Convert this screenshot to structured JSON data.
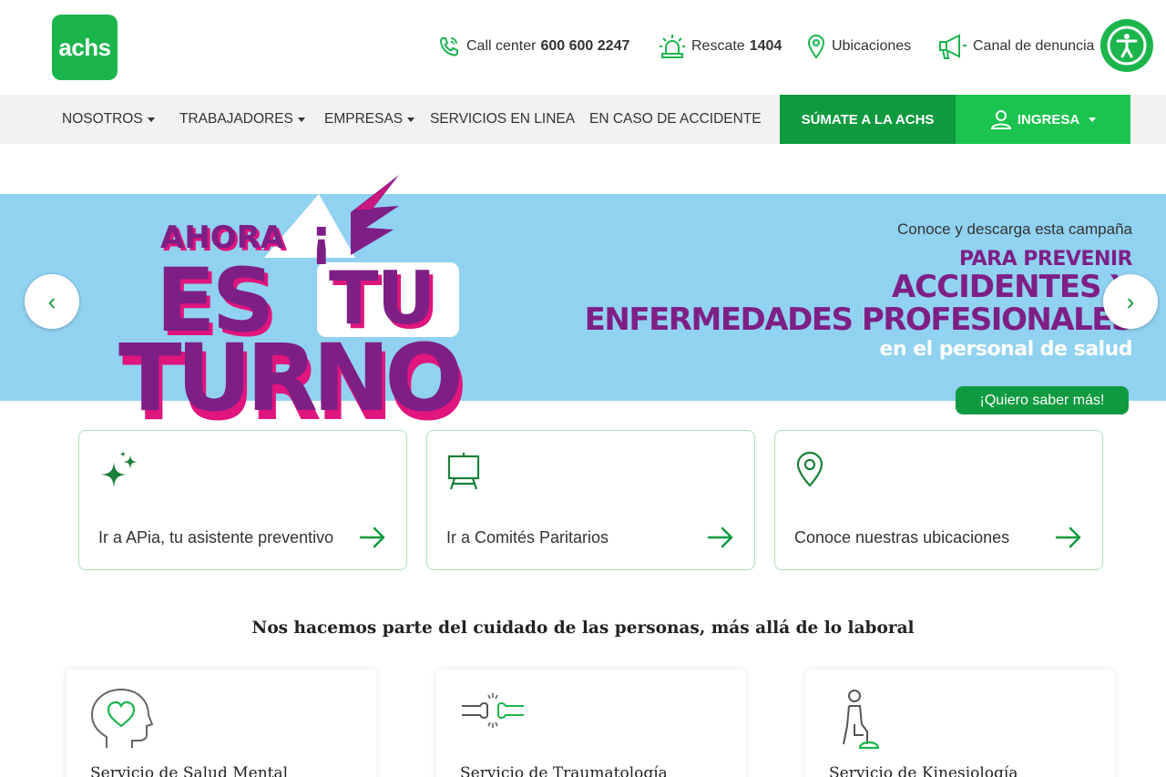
{
  "header": {
    "logo_text": "achs",
    "utility_links": [
      {
        "label": "Call center",
        "value": "600 600 2247",
        "icon": "phone-icon"
      },
      {
        "label": "Rescate",
        "value": "1404",
        "icon": "siren-icon"
      },
      {
        "label": "Ubicaciones",
        "icon": "location-pin-icon"
      },
      {
        "label": "Canal de denuncia",
        "icon": "megaphone-icon"
      }
    ],
    "accessibility_icon": "accessibility-icon"
  },
  "nav": {
    "items": [
      {
        "label": "NOSOTROS",
        "dropdown": true
      },
      {
        "label": "TRABAJADORES",
        "dropdown": true
      },
      {
        "label": "EMPRESAS",
        "dropdown": true
      },
      {
        "label": "SERVICIOS EN LINEA",
        "dropdown": false
      },
      {
        "label": "EN CASO DE ACCIDENTE",
        "dropdown": false
      }
    ],
    "join_label": "SÚMATE A LA ACHS",
    "login_label": "INGRESA"
  },
  "hero": {
    "art_text": {
      "line1": "AHORA",
      "exclaim": "¡",
      "line2a": "ES",
      "line2b": "TU",
      "line3": "TURNO"
    },
    "kicker": "Conoce y descarga esta campaña",
    "line1": "PARA PREVENIR",
    "line2": "ACCIDENTES Y",
    "line3": "ENFERMEDADES PROFESIONALES",
    "line4": "en el personal de salud",
    "cta_label": "¡Quiero saber más!",
    "prev_arrow": "‹",
    "next_arrow": "›",
    "colors": {
      "background": "#91d2f1",
      "purple": "#7e1f86",
      "pink": "#e0157d"
    }
  },
  "quick_links": [
    {
      "label": "Ir a APia, tu asistente preventivo",
      "icon": "sparkles-icon"
    },
    {
      "label": "Ir a Comités Paritarios",
      "icon": "easel-icon"
    },
    {
      "label": "Conoce nuestras ubicaciones",
      "icon": "location-pin-icon"
    }
  ],
  "section": {
    "title": "Nos hacemos parte del cuidado de las personas, más allá de lo laboral",
    "services": [
      {
        "label": "Servicio de Salud Mental",
        "icon": "head-heart-icon"
      },
      {
        "label": "Servicio de Traumatología",
        "icon": "bone-joint-icon"
      },
      {
        "label": "Servicio de Kinesiología",
        "icon": "person-step-icon"
      }
    ]
  },
  "colors": {
    "brand_green": "#1bb54c",
    "dark_green": "#0f9a3f",
    "nav_bg": "#f2f2f2"
  }
}
